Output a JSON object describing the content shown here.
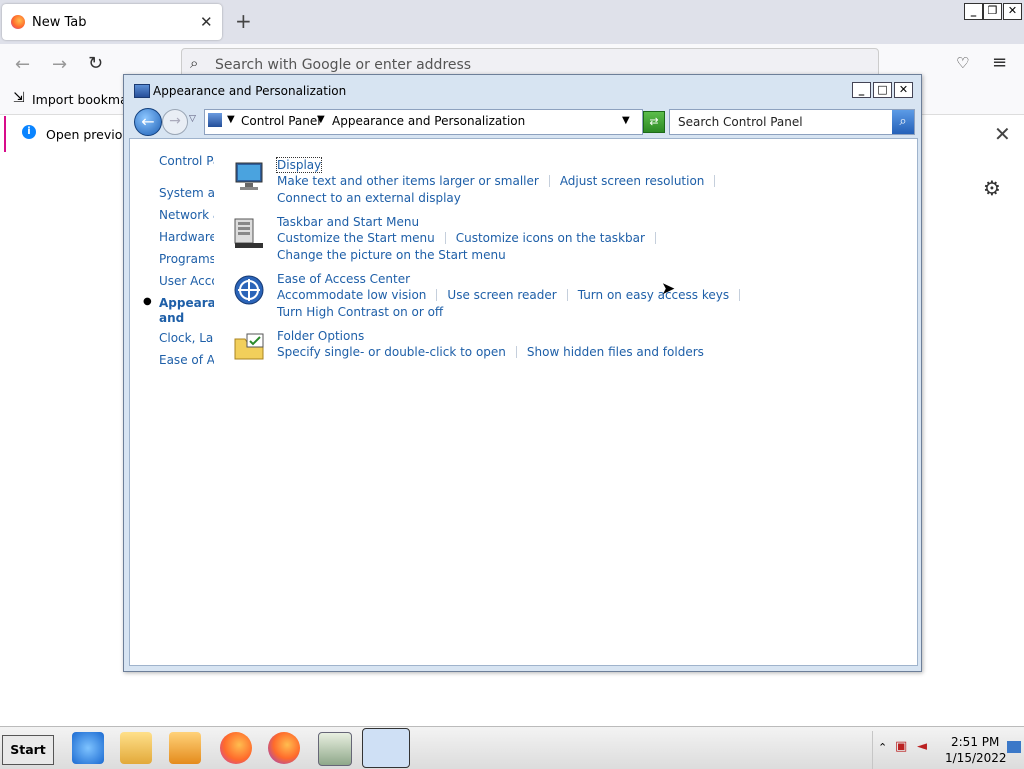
{
  "firefox": {
    "tab_title": "New Tab",
    "url_placeholder": "Search with Google or enter address",
    "bookmark_item": "Import bookmark",
    "notice_text": "Open previous"
  },
  "control_panel": {
    "window_title": "Appearance and Personalization",
    "breadcrumb": [
      "Control Panel",
      "Appearance and Personalization"
    ],
    "search_placeholder": "Search Control Panel",
    "nav": [
      {
        "label": "Control Pa"
      },
      {
        "label": "System an"
      },
      {
        "label": "Network a"
      },
      {
        "label": "Hardware"
      },
      {
        "label": "Programs"
      },
      {
        "label": "User Acco"
      },
      {
        "label": "Appearance and Personalization",
        "current": true
      },
      {
        "label": "Clock, Lan"
      },
      {
        "label": "Ease of Ac"
      }
    ],
    "sections": [
      {
        "title": "Display",
        "icon": "display-icon",
        "links": [
          [
            "Make text and other items larger or smaller",
            "Adjust screen resolution"
          ],
          [
            "Connect to an external display"
          ]
        ]
      },
      {
        "title": "Taskbar and Start Menu",
        "icon": "taskbar-icon",
        "links": [
          [
            "Customize the Start menu",
            "Customize icons on the taskbar"
          ],
          [
            "Change the picture on the Start menu"
          ]
        ]
      },
      {
        "title": "Ease of Access Center",
        "icon": "ease-of-access-icon",
        "links": [
          [
            "Accommodate low vision",
            "Use screen reader",
            "Turn on easy access keys"
          ],
          [
            "Turn High Contrast on or off"
          ]
        ]
      },
      {
        "title": "Folder Options",
        "icon": "folder-options-icon",
        "links": [
          [
            "Specify single- or double-click to open",
            "Show hidden files and folders"
          ]
        ]
      }
    ]
  },
  "taskbar": {
    "start_label": "Start",
    "time": "2:51 PM",
    "date": "1/15/2022"
  }
}
